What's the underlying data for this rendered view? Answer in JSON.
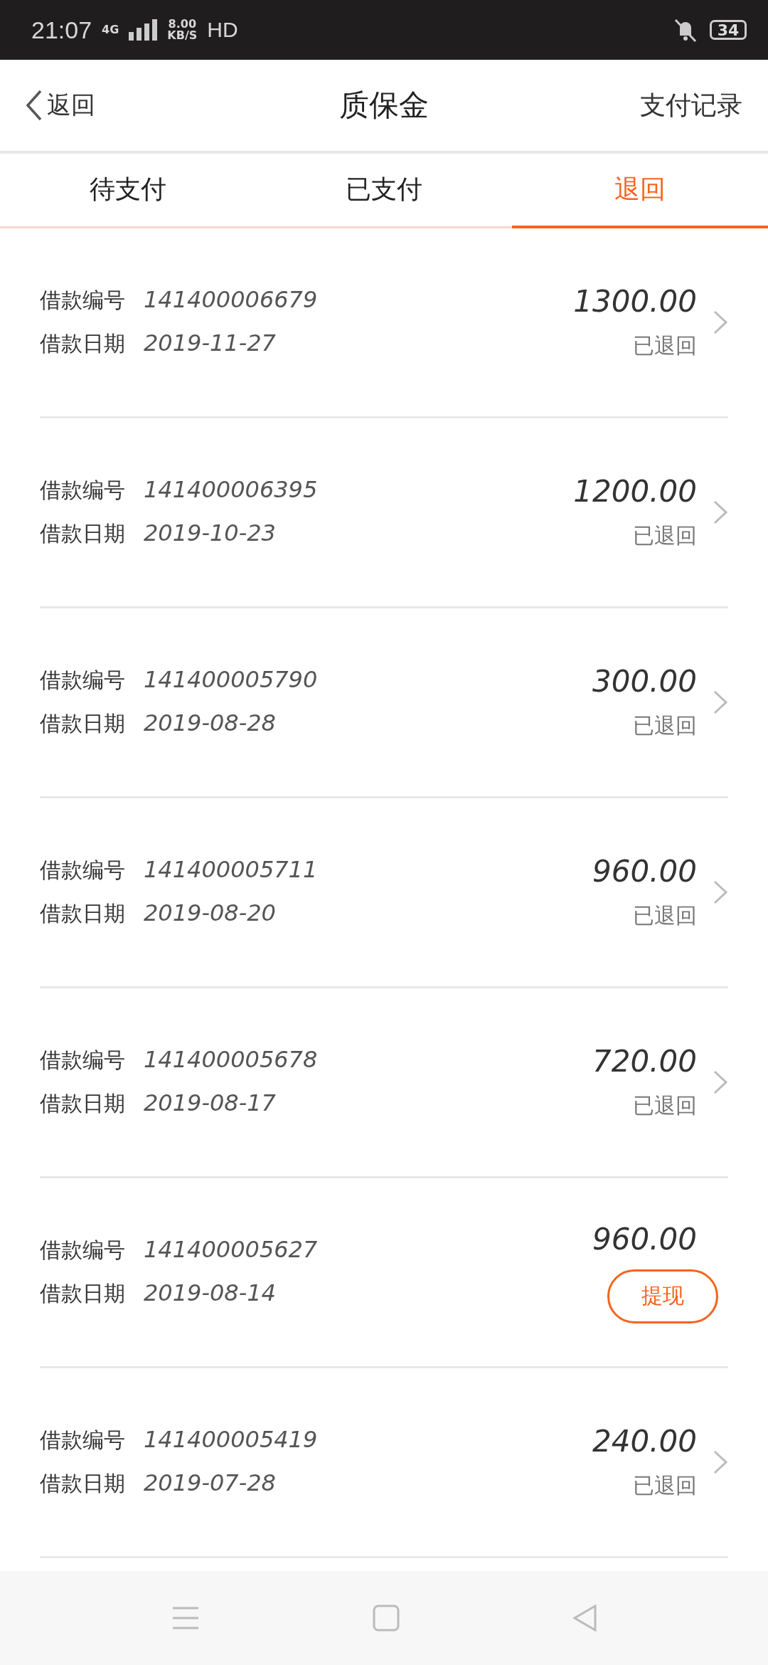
{
  "status_bar": {
    "time": "21:07",
    "network": "4G",
    "speed_value": "8.00",
    "speed_unit": "KB/S",
    "hd": "HD",
    "battery": "34"
  },
  "header": {
    "back": "返回",
    "title": "质保金",
    "action": "支付记录"
  },
  "tabs": [
    {
      "label": "待支付",
      "selected": false
    },
    {
      "label": "已支付",
      "selected": false
    },
    {
      "label": "退回",
      "selected": true
    }
  ],
  "rows": [
    {
      "kind": "returned",
      "number_label": "借款编号",
      "number": "141400006679",
      "date_label": "借款日期",
      "date": "2019-11-27",
      "amount": "1300.00",
      "status": "已退回"
    },
    {
      "kind": "returned",
      "number_label": "借款编号",
      "number": "141400006395",
      "date_label": "借款日期",
      "date": "2019-10-23",
      "amount": "1200.00",
      "status": "已退回"
    },
    {
      "kind": "returned",
      "number_label": "借款编号",
      "number": "141400005790",
      "date_label": "借款日期",
      "date": "2019-08-28",
      "amount": "300.00",
      "status": "已退回"
    },
    {
      "kind": "returned",
      "number_label": "借款编号",
      "number": "141400005711",
      "date_label": "借款日期",
      "date": "2019-08-20",
      "amount": "960.00",
      "status": "已退回"
    },
    {
      "kind": "returned",
      "number_label": "借款编号",
      "number": "141400005678",
      "date_label": "借款日期",
      "date": "2019-08-17",
      "amount": "720.00",
      "status": "已退回"
    },
    {
      "kind": "withdraw",
      "number_label": "借款编号",
      "number": "141400005627",
      "date_label": "借款日期",
      "date": "2019-08-14",
      "amount": "960.00",
      "status": "提现"
    },
    {
      "kind": "returned",
      "number_label": "借款编号",
      "number": "141400005419",
      "date_label": "借款日期",
      "date": "2019-07-28",
      "amount": "240.00",
      "status": "已退回"
    }
  ]
}
